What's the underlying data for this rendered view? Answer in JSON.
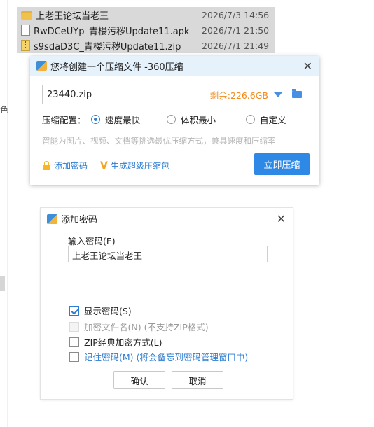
{
  "explorer": {
    "left_char": "色",
    "files": [
      {
        "name": "上老王论坛当老王",
        "date": "2026/7/3 14:56",
        "icon": "folder-icon"
      },
      {
        "name": "RwDCeUYp_青楼污秽Update11.apk",
        "date": "2026/7/1 21:50",
        "icon": "file-icon"
      },
      {
        "name": "s9sdaD3C_青楼污秽Update11.zip",
        "date": "2026/7/1 21:49",
        "icon": "zip-icon"
      }
    ]
  },
  "compress_dialog": {
    "title": "您将创建一个压缩文件 -360压缩",
    "path_value": "23440.zip",
    "free_space": "剩余:226.6GB",
    "config_label": "压缩配置：",
    "options": [
      "速度最快",
      "体积最小",
      "自定义"
    ],
    "selected_option": "速度最快",
    "hint": "智能为图片、视频、文档等挑选最优压缩方式，兼具速度和压缩率",
    "add_password_link": "添加密码",
    "super_package_link": "生成超级压缩包",
    "compress_button": "立即压缩",
    "accent_color": "#2d88e6"
  },
  "password_dialog": {
    "title": "添加密码",
    "input_label": "输入密码(E)",
    "password_value": "上老王论坛当老王",
    "options": [
      {
        "label": "显示密码(S)",
        "checked": true,
        "disabled": false
      },
      {
        "label": "加密文件名(N) (不支持ZIP格式)",
        "checked": false,
        "disabled": true
      },
      {
        "label": "ZIP经典加密方式(L)",
        "checked": false,
        "disabled": false
      },
      {
        "label": "记住密码(M) (将会备忘到密码管理窗口中)",
        "checked": false,
        "disabled": false
      }
    ],
    "ok_button": "确认",
    "cancel_button": "取消"
  }
}
